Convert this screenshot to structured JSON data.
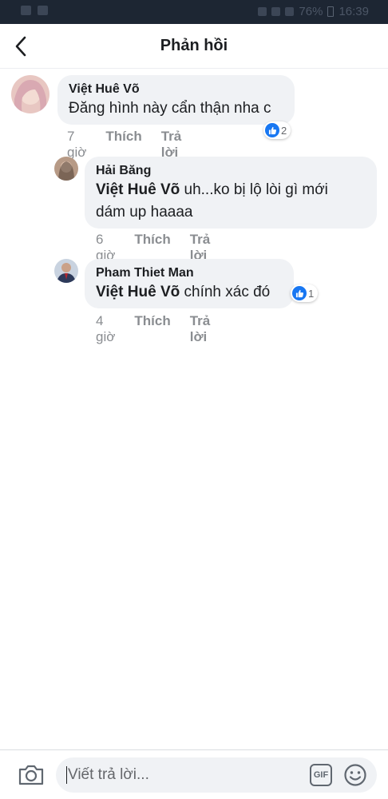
{
  "status_bar": {
    "battery": "76%",
    "time": "16:39"
  },
  "header": {
    "title": "Phản hồi"
  },
  "comments": [
    {
      "author": "Việt Huê Võ",
      "text": "Đăng hình này cẩn thận nha c",
      "time": "7 giờ",
      "like_label": "Thích",
      "reply_label": "Trả lời",
      "reactions": "2"
    },
    {
      "author": "Hải Băng",
      "mention": "Việt Huê Võ",
      "text_line1": " uh...ko bị lộ lòi gì mới",
      "text_line2": "dám up haaaa",
      "time": "6 giờ",
      "like_label": "Thích",
      "reply_label": "Trả lời"
    },
    {
      "author": "Pham Thiet Man",
      "mention": "Việt Huê Võ",
      "text": " chính xác đó",
      "time": "4 giờ",
      "like_label": "Thích",
      "reply_label": "Trả lời",
      "reactions": "1"
    }
  ],
  "composer": {
    "placeholder": "Viết trả lời...",
    "gif_label": "GIF"
  }
}
